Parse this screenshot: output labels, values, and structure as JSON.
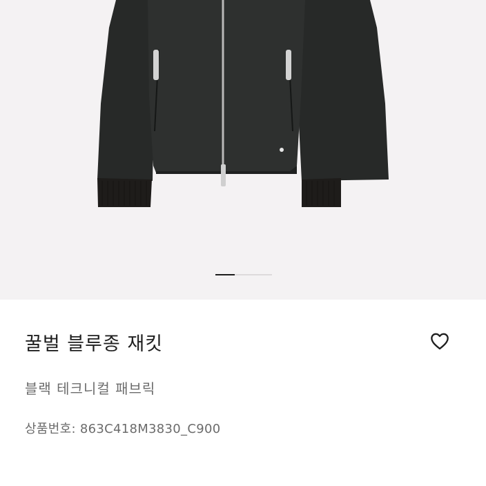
{
  "product": {
    "name": "꿀벌 블루종 재킷",
    "color_material": "블랙 테크니컬 패브릭",
    "sku": "상품번호: 863C418M3830_C900"
  },
  "gallery": {
    "active_index": 1,
    "total": 3
  },
  "icons": {
    "wishlist": "heart-outline-icon"
  },
  "colors": {
    "image_background": "#f4f2f3",
    "jacket": "#2b2d2c",
    "cuff": "#1e1c1a",
    "text_primary": "#1f1f1f",
    "text_secondary": "#6b6b6b"
  }
}
